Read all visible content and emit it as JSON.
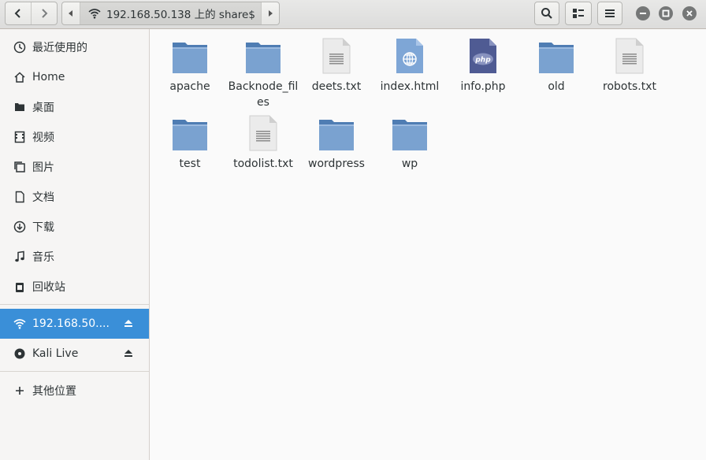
{
  "header": {
    "location": "192.168.50.138 上的 share$"
  },
  "sidebar": {
    "places": [
      {
        "label": "最近使用的",
        "icon": "recent-icon"
      },
      {
        "label": "Home",
        "icon": "home-icon"
      },
      {
        "label": "桌面",
        "icon": "desktop-icon"
      },
      {
        "label": "视频",
        "icon": "video-icon"
      },
      {
        "label": "图片",
        "icon": "picture-icon"
      },
      {
        "label": "文档",
        "icon": "document-icon"
      },
      {
        "label": "下载",
        "icon": "download-icon"
      },
      {
        "label": "音乐",
        "icon": "music-icon"
      },
      {
        "label": "回收站",
        "icon": "trash-icon"
      }
    ],
    "mounts": [
      {
        "label": "192.168.50....",
        "icon": "network-icon",
        "active": true
      },
      {
        "label": "Kali Live",
        "icon": "disc-icon",
        "active": false
      }
    ],
    "other": {
      "label": "其他位置",
      "icon": "plus-icon"
    }
  },
  "files": [
    {
      "name": "apache",
      "type": "folder"
    },
    {
      "name": "Backnode_files",
      "type": "folder"
    },
    {
      "name": "deets.txt",
      "type": "text"
    },
    {
      "name": "index.html",
      "type": "html"
    },
    {
      "name": "info.php",
      "type": "php"
    },
    {
      "name": "old",
      "type": "folder"
    },
    {
      "name": "robots.txt",
      "type": "text"
    },
    {
      "name": "test",
      "type": "folder"
    },
    {
      "name": "todolist.txt",
      "type": "text"
    },
    {
      "name": "wordpress",
      "type": "folder"
    },
    {
      "name": "wp",
      "type": "folder"
    }
  ],
  "icon_labels": {
    "php": "php"
  },
  "colors": {
    "accent": "#3a8fd8",
    "folder": "#6d97c7",
    "php": "#4f5b93"
  }
}
